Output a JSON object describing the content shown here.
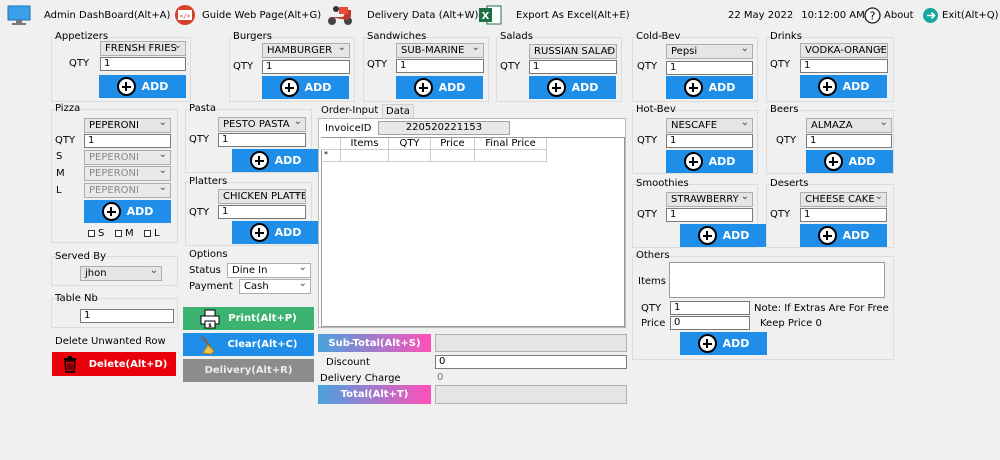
{
  "toolbar": {
    "dashboard": "Admin DashBoard(Alt+A)",
    "guide": "Guide Web Page(Alt+G)",
    "delivery": "Delivery Data (Alt+W)",
    "export": "Export As Excel(Alt+E)",
    "date": "22 May 2022",
    "time": "10:12:00 AM",
    "about": "About",
    "exit": "Exit(Alt+Q)"
  },
  "common": {
    "qty": "QTY",
    "add": "ADD",
    "qty_value": "1"
  },
  "appetizers": {
    "title": "Appetizers",
    "selected": "FRENSH FRIES"
  },
  "burgers": {
    "title": "Burgers",
    "selected": "HAMBURGER"
  },
  "sandwiches": {
    "title": "Sandwiches",
    "selected": "SUB-MARINE"
  },
  "salads": {
    "title": "Salads",
    "selected": "RUSSIAN SALAD"
  },
  "coldbev": {
    "title": "Cold-Bev",
    "selected": "Pepsi"
  },
  "drinks": {
    "title": "Drinks",
    "selected": "VODKA-ORANGE"
  },
  "pizza": {
    "title": "Pizza",
    "selected": "PEPERONI",
    "size_s": "S",
    "size_m": "M",
    "size_l": "L",
    "s_value": "PEPERONI",
    "m_value": "PEPERONI",
    "l_value": "PEPERONI",
    "chk_s": "S",
    "chk_m": "M",
    "chk_l": "L"
  },
  "pasta": {
    "title": "Pasta",
    "selected": "PESTO PASTA"
  },
  "platters": {
    "title": "Platters",
    "selected": "CHICKEN PLATTER"
  },
  "hotbev": {
    "title": "Hot-Bev",
    "selected": "NESCAFE"
  },
  "beers": {
    "title": "Beers",
    "selected": "ALMAZA"
  },
  "smoothies": {
    "title": "Smoothies",
    "selected": "STRAWBERRY"
  },
  "deserts": {
    "title": "Deserts",
    "selected": "CHEESE CAKE"
  },
  "order": {
    "tab1": "Order-Input",
    "tab2": "Data",
    "invoice_label": "InvoiceID",
    "invoice_value": "220520221153",
    "columns": [
      "Items",
      "QTY",
      "Price",
      "Final Price"
    ],
    "new_row": "*"
  },
  "served": {
    "title": "Served By",
    "selected": "jhon"
  },
  "table": {
    "title": "Table Nb",
    "value": "1"
  },
  "delete": {
    "title": "Delete Unwanted Row",
    "label": "Delete(Alt+D)"
  },
  "options": {
    "title": "Options",
    "status_label": "Status",
    "status_value": "Dine In",
    "payment_label": "Payment",
    "payment_value": "Cash"
  },
  "actions": {
    "print": "Print(Alt+P)",
    "clear": "Clear(Alt+C)",
    "delivery": "Delivery(Alt+R)"
  },
  "totals": {
    "subtotal": "Sub-Total(Alt+S)",
    "discount_label": "Discount",
    "discount_value": "0",
    "delivery_label": "Delivery Charge",
    "delivery_value": "0",
    "total": "Total(Alt+T)"
  },
  "others": {
    "title": "Others",
    "items_label": "Items",
    "qty_label": "QTY",
    "qty_value": "1",
    "price_label": "Price",
    "price_value": "0",
    "note1": "Note: If Extras Are For Free",
    "note2": "Keep Price 0"
  },
  "colors": {
    "accent": "#1e8ee8",
    "print": "#3cb371",
    "delete": "#e8000b",
    "subtotal_gradient": [
      "#4aa3df",
      "#ff4fb8"
    ]
  }
}
